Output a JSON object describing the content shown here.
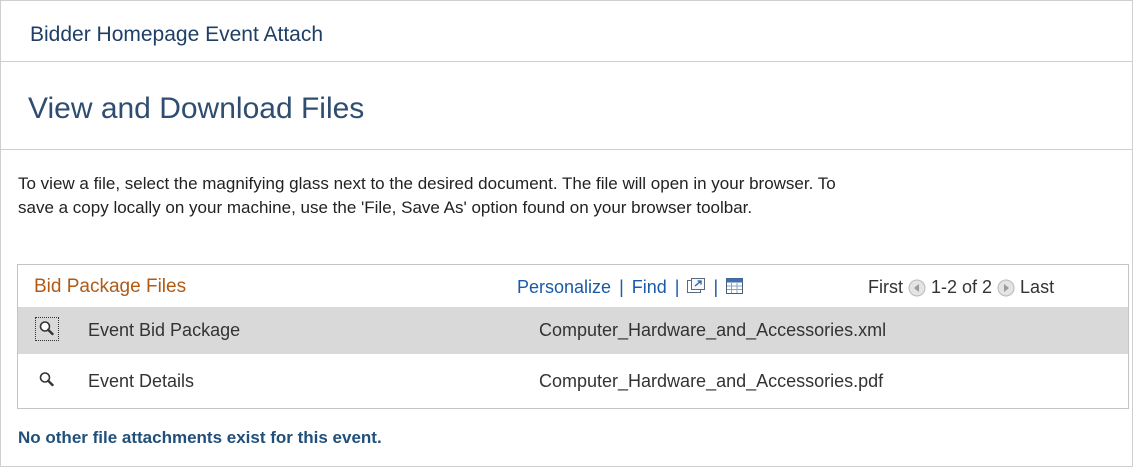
{
  "window": {
    "title": "Bidder Homepage Event Attach"
  },
  "page": {
    "title": "View and Download Files"
  },
  "instructions": {
    "line1": "To view a file, select the magnifying glass next to the desired document.  The file will open in your browser.  To",
    "line2": "save a copy locally on your machine, use the 'File, Save As' option found on your browser toolbar."
  },
  "grid": {
    "title": "Bid Package Files",
    "personalize_label": "Personalize",
    "find_label": "Find",
    "separator": "|",
    "pager": {
      "first_label": "First",
      "range_label": "1-2 of 2",
      "last_label": "Last"
    },
    "rows": [
      {
        "description": "Event Bid Package",
        "file": "Computer_Hardware_and_Accessories.xml",
        "view_icon": "magnifying-glass-icon"
      },
      {
        "description": "Event Details",
        "file": "Computer_Hardware_and_Accessories.pdf",
        "view_icon": "magnifying-glass-icon"
      }
    ]
  },
  "footer_note": "No other file attachments exist for this event.",
  "colors": {
    "heading": "#2e4d70",
    "grid_title": "#b05a16",
    "link": "#1a5aa8",
    "selected_row": "#d9d9d9"
  }
}
